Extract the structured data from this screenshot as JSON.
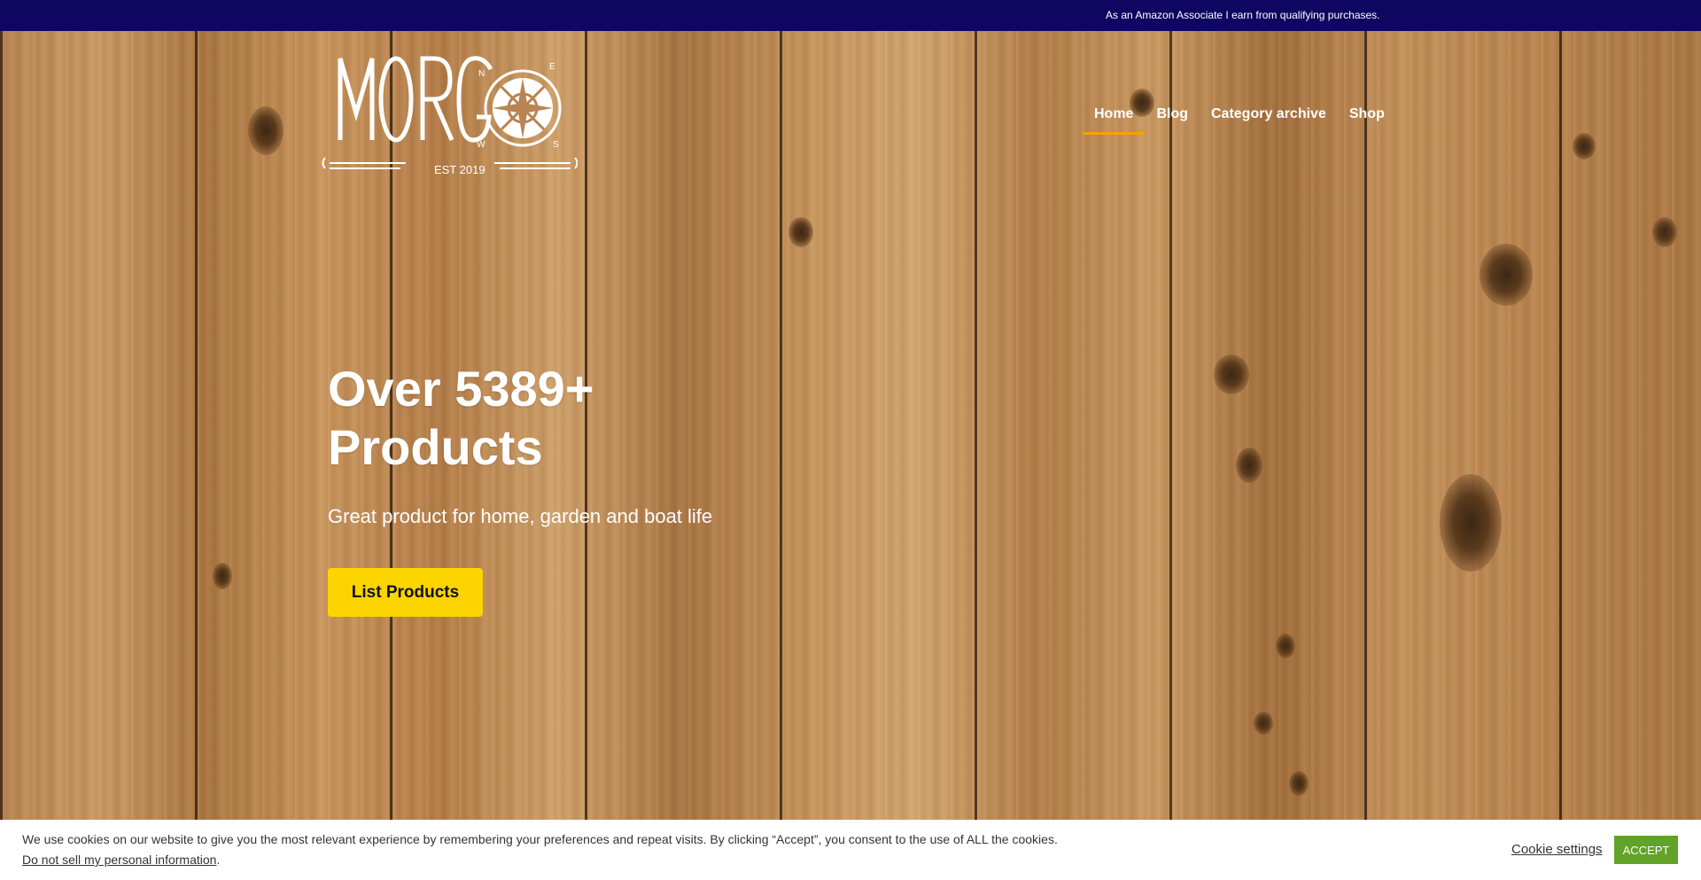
{
  "topbar": {
    "notice": "As an Amazon Associate I earn from qualifying purchases."
  },
  "logo": {
    "wordmark": "MORG",
    "tagline": "EST 2019",
    "compass_letters": [
      "N",
      "E",
      "S",
      "W"
    ]
  },
  "nav": {
    "items": [
      {
        "label": "Home",
        "active": true
      },
      {
        "label": "Blog",
        "active": false
      },
      {
        "label": "Category archive",
        "active": false
      },
      {
        "label": "Shop",
        "active": false
      }
    ]
  },
  "hero": {
    "title_line1": "Over 5389+",
    "title_line2": "Products",
    "subtitle": "Great product for home, garden and boat life",
    "button_label": "List Products"
  },
  "cookie": {
    "message": "We use cookies on our website to give you the most relevant experience by remembering your preferences and repeat visits. By clicking “Accept”, you consent to the use of ALL the cookies.",
    "dns_link": "Do not sell my personal information",
    "dns_suffix": ".",
    "settings_label": "Cookie settings",
    "accept_label": "ACCEPT"
  },
  "colors": {
    "topbar_bg": "#0e0661",
    "nav_active_underline": "#f5a300",
    "cta_bg": "#fcd400",
    "accept_bg": "#61a229"
  }
}
